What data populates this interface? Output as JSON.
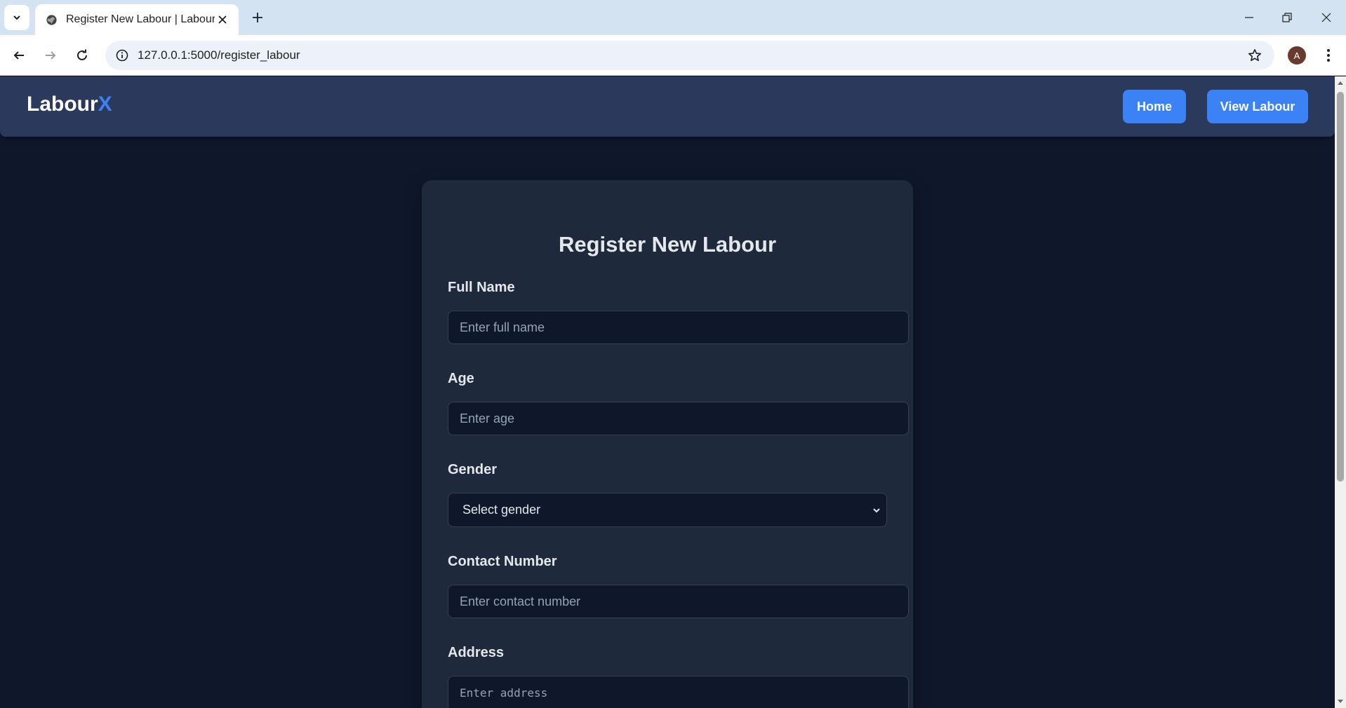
{
  "browser": {
    "tab_title": "Register New Labour | LabourX",
    "url": "127.0.0.1:5000/register_labour",
    "profile_initial": "A",
    "icons": {
      "tab_list": "chevron-down-icon",
      "favicon": "globe-icon",
      "tab_close": "close-icon",
      "new_tab": "plus-icon",
      "back": "arrow-left-icon",
      "forward": "arrow-right-icon",
      "reload": "reload-icon",
      "site_info": "info-icon",
      "bookmark": "star-icon",
      "menu": "kebab-menu-icon",
      "minimize": "minimize-icon",
      "restore": "restore-icon",
      "close": "close-icon"
    }
  },
  "navbar": {
    "brand_main": "Labour",
    "brand_accent": "X",
    "links": [
      {
        "label": "Home"
      },
      {
        "label": "View Labour"
      }
    ]
  },
  "form": {
    "title": "Register New Labour",
    "full_name": {
      "label": "Full Name",
      "placeholder": "Enter full name"
    },
    "age": {
      "label": "Age",
      "placeholder": "Enter age"
    },
    "gender": {
      "label": "Gender",
      "selected": "Select gender"
    },
    "contact": {
      "label": "Contact Number",
      "placeholder": "Enter contact number"
    },
    "address": {
      "label": "Address",
      "placeholder": "Enter address"
    }
  },
  "colors": {
    "page_bg": "#0f172a",
    "navbar_bg": "#2b3a5c",
    "card_bg": "#1e293b",
    "accent": "#3b82f6"
  }
}
